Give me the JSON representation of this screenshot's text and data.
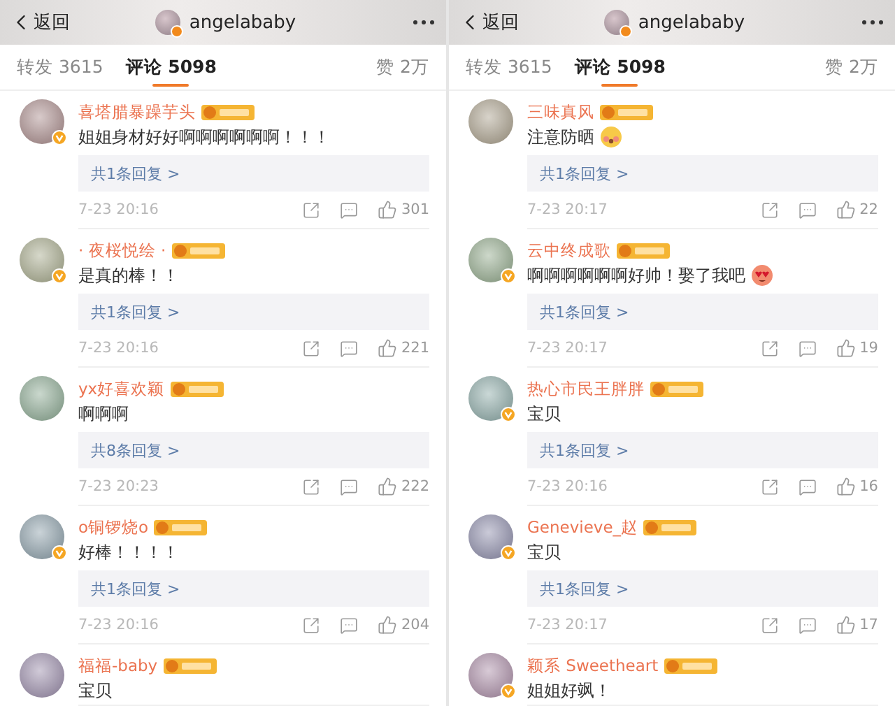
{
  "panels": [
    {
      "header": {
        "back_label": "返回",
        "username": "angelababy"
      },
      "tabs": [
        {
          "label": "转发 3615",
          "selected": false
        },
        {
          "label": "评论 5098",
          "selected": true
        },
        {
          "label": "赞 2万",
          "selected": false
        }
      ],
      "comments": [
        {
          "name": "喜塔腊暴躁芋头",
          "verified": true,
          "text": "姐姐身材好好啊啊啊啊啊啊！！！",
          "replies": "共1条回复 >",
          "time": "7-23 20:16",
          "likes": "301"
        },
        {
          "name": "· 夜桜悦绘 ·",
          "verified": true,
          "text": "是真的棒！！",
          "replies": "共1条回复 >",
          "time": "7-23 20:16",
          "likes": "221"
        },
        {
          "name": "yx好喜欢颖",
          "verified": false,
          "text": "啊啊啊",
          "replies": "共8条回复 >",
          "time": "7-23 20:23",
          "likes": "222"
        },
        {
          "name": "o铜锣烧o",
          "verified": true,
          "text": "好棒！！！！",
          "replies": "共1条回复 >",
          "time": "7-23 20:16",
          "likes": "204"
        },
        {
          "name": "福福-baby",
          "verified": false,
          "text": "宝贝"
        }
      ]
    },
    {
      "header": {
        "back_label": "返回",
        "username": "angelababy"
      },
      "tabs": [
        {
          "label": "转发 3615",
          "selected": false
        },
        {
          "label": "评论 5098",
          "selected": true
        },
        {
          "label": "赞 2万",
          "selected": false
        }
      ],
      "comments": [
        {
          "name": "三味真风",
          "verified": false,
          "text": "注意防晒",
          "kind": "blush",
          "replies": "共1条回复 >",
          "time": "7-23 20:17",
          "likes": "22"
        },
        {
          "name": "云中终成歌",
          "verified": true,
          "text": "啊啊啊啊啊啊好帅！娶了我吧",
          "kind": "hearts",
          "replies": "共1条回复 >",
          "time": "7-23 20:17",
          "likes": "19"
        },
        {
          "name": "热心市民王胖胖",
          "verified": true,
          "text": "宝贝",
          "replies": "共1条回复 >",
          "time": "7-23 20:16",
          "likes": "16"
        },
        {
          "name": "Genevieve_赵",
          "verified": true,
          "text": "宝贝",
          "replies": "共1条回复 >",
          "time": "7-23 20:17",
          "likes": "17"
        },
        {
          "name": "颖系 Sweetheart",
          "verified": true,
          "text": "姐姐好飒！"
        }
      ]
    }
  ]
}
